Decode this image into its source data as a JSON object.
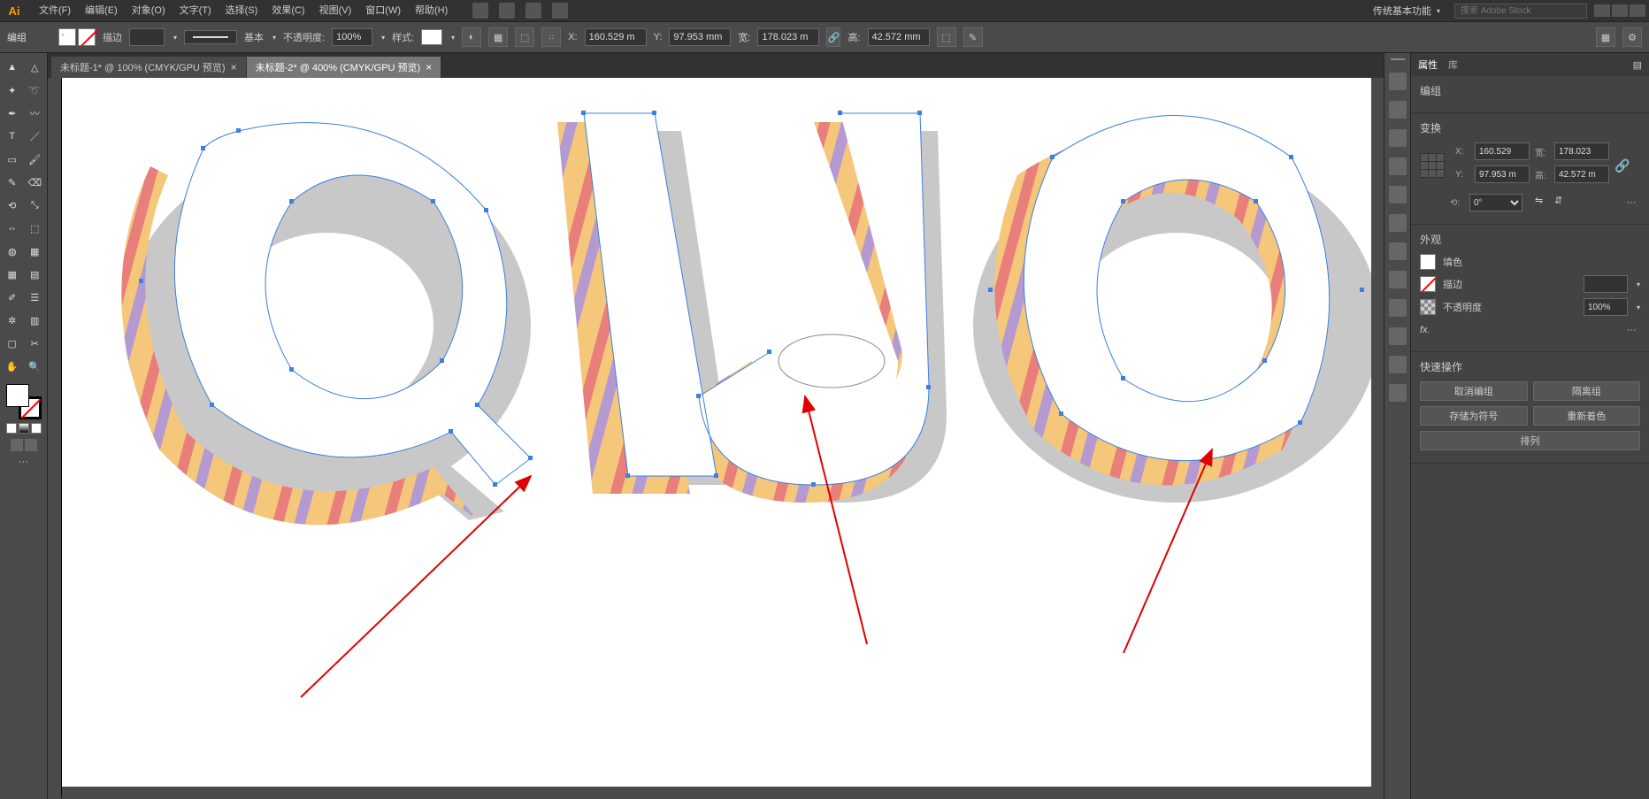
{
  "menubar": {
    "logo": "Ai",
    "items": [
      "文件(F)",
      "编辑(E)",
      "对象(O)",
      "文字(T)",
      "选择(S)",
      "效果(C)",
      "视图(V)",
      "窗口(W)",
      "帮助(H)"
    ],
    "workspace": "传统基本功能",
    "search_placeholder": "搜索 Adobe Stock"
  },
  "control": {
    "context": "编组",
    "stroke_label": "描边",
    "stroke_weight": "",
    "brush_style": "基本",
    "opacity_label": "不透明度:",
    "opacity": "100%",
    "style_label": "样式:",
    "x_label": "X:",
    "x": "160.529 m",
    "y_label": "Y:",
    "y": "97.953 mm",
    "w_label": "宽:",
    "w": "178.023 m",
    "h_label": "高:",
    "h": "42.572 mm"
  },
  "tabs": [
    {
      "label": "未标题-1* @ 100% (CMYK/GPU 预览)",
      "active": false
    },
    {
      "label": "未标题-2* @ 400% (CMYK/GPU 预览)",
      "active": true
    }
  ],
  "props": {
    "panel_tabs": [
      "属性",
      "库"
    ],
    "context": "编组",
    "transform_title": "变换",
    "x_lbl": "X:",
    "x": "160.529",
    "w_lbl": "宽:",
    "w": "178.023",
    "y_lbl": "Y:",
    "y": "97.953 m",
    "h_lbl": "高:",
    "h": "42.572 m",
    "rot_lbl": "⟲:",
    "rot": "0°",
    "appearance_title": "外观",
    "fill_label": "填色",
    "stroke_label": "描边",
    "stroke_weight": "",
    "opacity_label": "不透明度",
    "opacity": "100%",
    "fx": "fx.",
    "quick_title": "快速操作",
    "btn_ungroup": "取消编组",
    "btn_isolate": "隔离组",
    "btn_savesym": "存储为符号",
    "btn_recolor": "重新着色",
    "btn_align": "排列"
  },
  "tools": [
    [
      "selection",
      "direct-selection"
    ],
    [
      "magic-wand",
      "lasso"
    ],
    [
      "pen",
      "curvature"
    ],
    [
      "type",
      "line"
    ],
    [
      "rectangle",
      "paintbrush"
    ],
    [
      "shaper",
      "eraser"
    ],
    [
      "rotate",
      "scale"
    ],
    [
      "width",
      "free-transform"
    ],
    [
      "shape-builder",
      "perspective"
    ],
    [
      "mesh",
      "gradient"
    ],
    [
      "eyedropper",
      "blend"
    ],
    [
      "symbol-sprayer",
      "graph"
    ],
    [
      "artboard",
      "slice"
    ],
    [
      "hand",
      "zoom"
    ]
  ],
  "dock_icons": [
    "color",
    "swatches",
    "brushes",
    "symbols",
    "stroke",
    "gradient",
    "transparency",
    "appearance",
    "graphic-styles",
    "layers",
    "links",
    "actions"
  ]
}
